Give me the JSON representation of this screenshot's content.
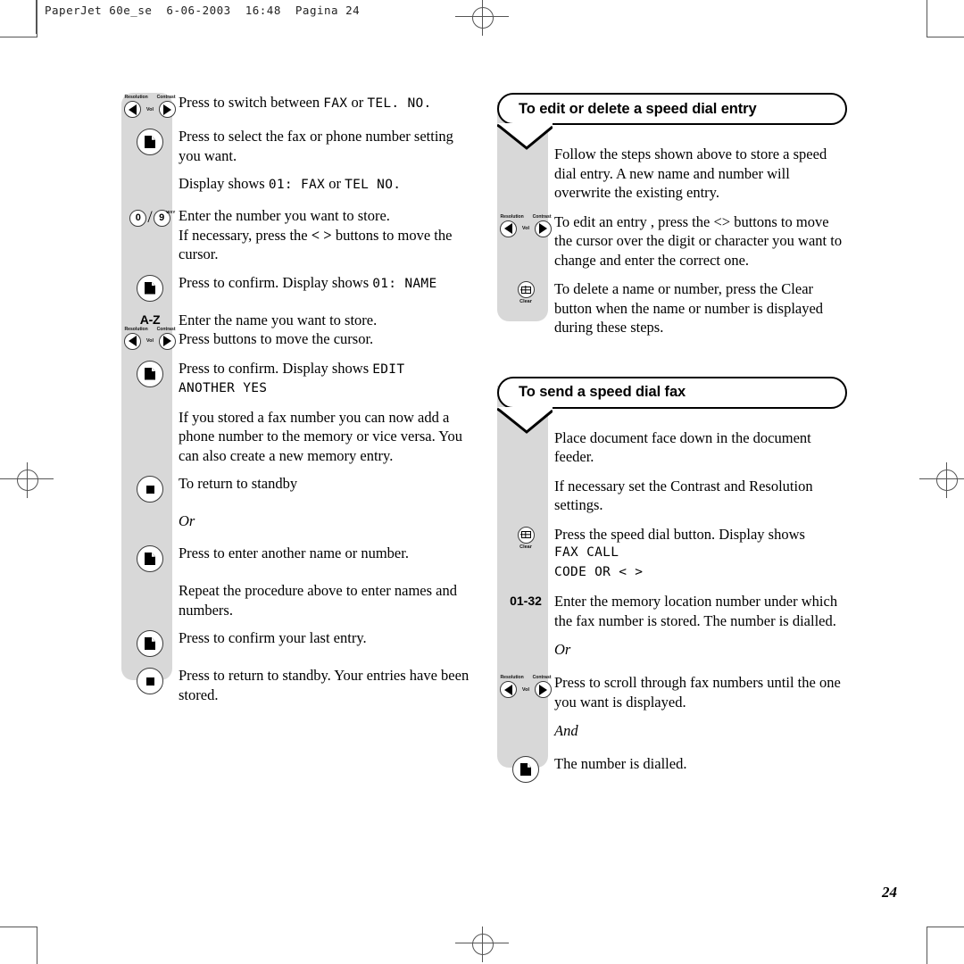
{
  "header": {
    "text": "PaperJet 60e_se  6-06-2003  16:48  Pagina 24"
  },
  "page_number": "24",
  "icons": {
    "resolution_label": "Resolution",
    "contrast_label": "Contrast",
    "vol_label": "Vol",
    "clear_label": "Clear",
    "keypad_zero": "0",
    "keypad_nine": "9",
    "keypad_nine_sup": "WXY",
    "keypad_slash": "/",
    "az_label": "A-Z",
    "range_label": "01-32"
  },
  "left_column": {
    "steps": [
      {
        "icon": "arrows",
        "lines": [
          {
            "type": "mixed",
            "parts": [
              {
                "t": "text",
                "v": "Press to switch between "
              },
              {
                "t": "lcd",
                "v": "FAX"
              },
              {
                "t": "text",
                "v": " or "
              },
              {
                "t": "lcd",
                "v": "TEL. NO."
              }
            ]
          }
        ]
      },
      {
        "icon": "page",
        "lines": [
          {
            "type": "text",
            "v": "Press to select the fax or phone number setting you want."
          }
        ]
      },
      {
        "icon": "none",
        "lines": [
          {
            "type": "mixed",
            "parts": [
              {
                "t": "text",
                "v": "Display shows "
              },
              {
                "t": "lcd",
                "v": "01: FAX"
              },
              {
                "t": "text",
                "v": " or "
              },
              {
                "t": "lcd",
                "v": "TEL NO."
              }
            ]
          }
        ]
      },
      {
        "icon": "keypad",
        "lines": [
          {
            "type": "text",
            "v": "Enter the number you want to store."
          },
          {
            "type": "mixed",
            "parts": [
              {
                "t": "text",
                "v": "If necessary, press the "
              },
              {
                "t": "bold",
                "v": "< >"
              },
              {
                "t": "text",
                "v": " buttons to move the cursor."
              }
            ]
          }
        ]
      },
      {
        "icon": "page",
        "lines": [
          {
            "type": "mixed",
            "parts": [
              {
                "t": "text",
                "v": "Press to confirm. Display shows "
              },
              {
                "t": "lcd",
                "v": "01: NAME"
              }
            ]
          }
        ]
      },
      {
        "icon": "az",
        "lines": [
          {
            "type": "text",
            "v": "Enter the name you want to store."
          },
          {
            "type": "text",
            "v": "Press buttons to move the cursor."
          }
        ]
      },
      {
        "icon": "page",
        "lines": [
          {
            "type": "mixed",
            "parts": [
              {
                "t": "text",
                "v": "Press to confirm. Display shows "
              },
              {
                "t": "lcd",
                "v": "EDIT"
              }
            ]
          },
          {
            "type": "lcd",
            "v": "ANOTHER YES"
          }
        ]
      },
      {
        "icon": "none",
        "lines": [
          {
            "type": "text",
            "v": "If you stored a fax number you can now add a phone number to the memory or vice versa. You can also create a new memory entry."
          }
        ]
      },
      {
        "icon": "stop",
        "lines": [
          {
            "type": "text",
            "v": "To return to standby"
          }
        ]
      },
      {
        "icon": "none",
        "lines": [
          {
            "type": "italic",
            "v": "Or"
          }
        ]
      },
      {
        "icon": "page",
        "lines": [
          {
            "type": "text",
            "v": "Press to enter another name or number."
          }
        ]
      },
      {
        "icon": "none",
        "lines": [
          {
            "type": "text",
            "v": "Repeat the procedure above to enter names and numbers."
          }
        ]
      },
      {
        "icon": "page",
        "lines": [
          {
            "type": "text",
            "v": "Press to confirm your last entry."
          }
        ]
      },
      {
        "icon": "stop",
        "lines": [
          {
            "type": "text",
            "v": "Press to return to standby. Your entries have been stored."
          }
        ]
      }
    ]
  },
  "right_column": {
    "sections": [
      {
        "title": "To edit or delete a speed dial entry",
        "steps": [
          {
            "icon": "none",
            "lines": [
              {
                "type": "text",
                "v": "Follow the steps shown above to store a speed dial entry. A new name and number will overwrite the existing entry."
              }
            ]
          },
          {
            "icon": "arrows",
            "lines": [
              {
                "type": "text",
                "v": "To edit an entry , press the <> buttons to move the cursor over the digit or character you want to change and enter the correct one."
              }
            ]
          },
          {
            "icon": "clear",
            "lines": [
              {
                "type": "text",
                "v": "To delete a name or number, press the Clear button when the name or number is displayed during these steps."
              }
            ]
          }
        ]
      },
      {
        "title": "To send a speed dial fax",
        "steps": [
          {
            "icon": "none",
            "lines": [
              {
                "type": "text",
                "v": "Place document face down in the document feeder."
              }
            ]
          },
          {
            "icon": "none",
            "lines": [
              {
                "type": "text",
                "v": "If necessary set the Contrast and Resolution settings."
              }
            ]
          },
          {
            "icon": "clear",
            "lines": [
              {
                "type": "text",
                "v": "Press the speed dial button. Display shows"
              },
              {
                "type": "lcd",
                "v": "FAX CALL"
              },
              {
                "type": "lcd",
                "v": "CODE OR < >"
              }
            ]
          },
          {
            "icon": "range",
            "lines": [
              {
                "type": "text",
                "v": "Enter the memory location number under which the fax number is stored. The number is dialled."
              }
            ]
          },
          {
            "icon": "none",
            "lines": [
              {
                "type": "italic",
                "v": "Or"
              }
            ]
          },
          {
            "icon": "arrows",
            "lines": [
              {
                "type": "text",
                "v": "Press to scroll through fax numbers until the one you want is displayed."
              }
            ]
          },
          {
            "icon": "none",
            "lines": [
              {
                "type": "italic",
                "v": "And"
              }
            ]
          },
          {
            "icon": "page",
            "lines": [
              {
                "type": "text",
                "v": "The number is dialled."
              }
            ]
          }
        ]
      }
    ]
  }
}
